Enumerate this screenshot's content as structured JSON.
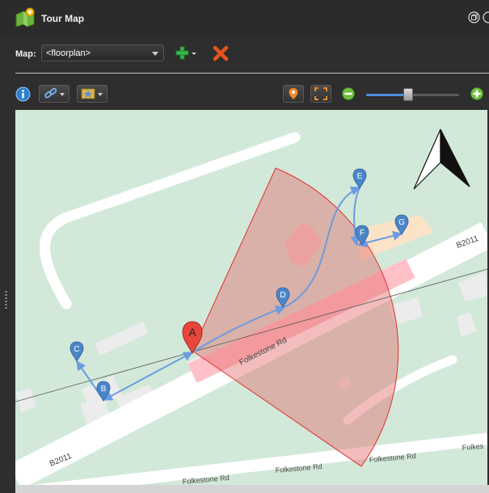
{
  "window": {
    "title": "Tour Map"
  },
  "icons": {
    "app": "tour-map-icon",
    "restore": "restore-window-icon",
    "close": "close-window-icon",
    "add": "add-plus-icon",
    "delete": "delete-x-icon",
    "info": "info-icon",
    "link": "link-icon",
    "style": "star-style-icon",
    "place_marker": "marker-pin-icon",
    "fit": "fit-to-view-icon",
    "zoom_out": "zoom-out-icon",
    "zoom_in": "zoom-in-icon",
    "north": "north-arrow-icon"
  },
  "mapbar": {
    "label": "Map:",
    "selected_map": "<floorplan>"
  },
  "zoom": {
    "level": 0.45
  },
  "map": {
    "roads": [
      {
        "name": "B2011"
      },
      {
        "name": "Folkestone Rd"
      },
      {
        "name": "B2011"
      },
      {
        "name": "Folkestone Rd"
      },
      {
        "name": "Folkestone Rd"
      },
      {
        "name": "Folkestone Rd"
      },
      {
        "name": "Folkes"
      }
    ],
    "markers": [
      {
        "label": "A",
        "type": "camera",
        "color": "#e8463d"
      },
      {
        "label": "B",
        "type": "tour-point",
        "color": "#4a86c8"
      },
      {
        "label": "C",
        "type": "tour-point",
        "color": "#4a86c8"
      },
      {
        "label": "D",
        "type": "tour-point",
        "color": "#4a86c8"
      },
      {
        "label": "E",
        "type": "tour-point",
        "color": "#4a86c8"
      },
      {
        "label": "F",
        "type": "tour-point",
        "color": "#4a86c8"
      },
      {
        "label": "G",
        "type": "tour-point",
        "color": "#4a86c8"
      }
    ],
    "colors": {
      "land": "#d2e9d9",
      "road": "#ffffff",
      "building": "#ececec",
      "highlight_building": "#fbe3c8",
      "view_cone": "#e46c6c",
      "route": "#6b9be0"
    }
  }
}
